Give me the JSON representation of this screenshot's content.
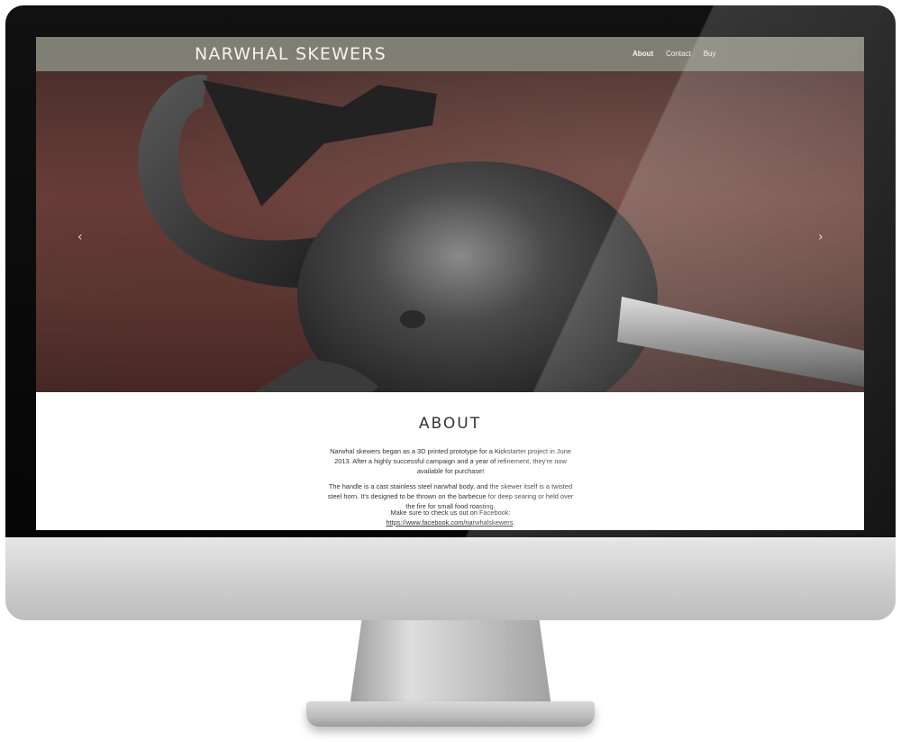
{
  "site": {
    "brand": "NARWHAL SKEWERS",
    "nav": [
      {
        "label": "About",
        "active": true
      },
      {
        "label": "Contact",
        "active": false
      },
      {
        "label": "Buy",
        "active": false
      }
    ]
  },
  "hero": {
    "prev_icon": "chevron-left-icon",
    "next_icon": "chevron-right-icon",
    "prev_glyph": "‹",
    "next_glyph": "›",
    "slide_count": 6,
    "active_slide": 1
  },
  "about": {
    "title": "ABOUT",
    "paragraph1": "Narwhal skewers began as a 3D printed prototype for a Kickstarter project in June 2013. After a highly successful campaign and a year of refinement, they're now available for purchase!",
    "paragraph2": "The handle is a cast stainless steel narwhal body, and the skewer itself is a twisted steel horn. It's designed to be thrown on the barbecue for deep searing or held over the fire for small food roasting.",
    "paragraph3_prefix": "Make sure to check us out on Facebook:",
    "facebook_link": "https://www.facebook.com/narwhalskewers",
    "link_suffix": "."
  },
  "colors": {
    "navbar": "#7f7f73",
    "text": "#333333"
  }
}
